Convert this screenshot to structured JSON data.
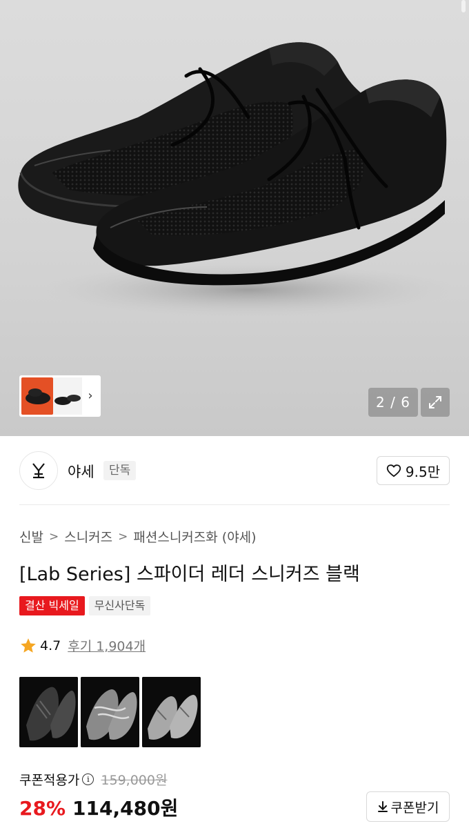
{
  "gallery": {
    "counter": "2 / 6",
    "thumb_next_icon": "chevron-right-icon",
    "expand_icon": "expand-icon"
  },
  "brand": {
    "logo_text": "Ꮥ",
    "name": "야세",
    "badge": "단독",
    "like_count": "9.5만",
    "like_icon": "heart-icon"
  },
  "breadcrumb": [
    "신발",
    "스니커즈",
    "패션스니커즈화 (야세)"
  ],
  "product": {
    "title": "[Lab Series] 스파이더 레더 스니커즈 블랙",
    "tags": [
      "결산 빅세일",
      "무신사단독"
    ],
    "rating": "4.7",
    "reviews": "후기 1,904개"
  },
  "pricing": {
    "coupon_label": "쿠폰적용가",
    "original_price": "159,000원",
    "discount": "28%",
    "price": "114,480원",
    "coupon_button": "쿠폰받기"
  },
  "colors": {
    "accent_red": "#e8191e",
    "star": "#f5a623"
  }
}
